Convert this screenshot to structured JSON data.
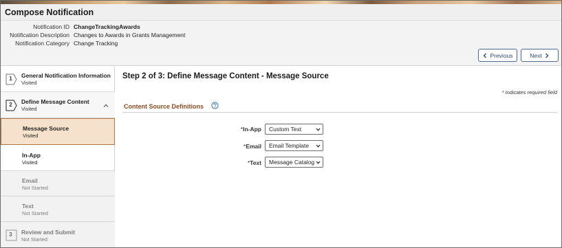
{
  "title": "Compose Notification",
  "header": {
    "fields": [
      {
        "label": "Notification ID",
        "value": "ChangeTrackingAwards"
      },
      {
        "label": "Notification Description",
        "value": "Changes to Awards in Grants Management"
      },
      {
        "label": "Notification Category",
        "value": "Change Tracking"
      }
    ],
    "previous_label": "Previous",
    "next_label": "Next"
  },
  "sidebar": {
    "steps": [
      {
        "number": "1",
        "title": "General Notification Information",
        "status": "Visited"
      },
      {
        "number": "2",
        "title": "Define Message Content",
        "status": "Visited"
      },
      {
        "number": "3",
        "title": "Review and Submit",
        "status": "Not Started"
      }
    ],
    "substeps": [
      {
        "title": "Message Source",
        "status": "Visited",
        "state": "active"
      },
      {
        "title": "In-App",
        "status": "Visited",
        "state": "normal"
      },
      {
        "title": "Email",
        "status": "Not Started",
        "state": "disabled"
      },
      {
        "title": "Text",
        "status": "Not Started",
        "state": "disabled"
      }
    ]
  },
  "main": {
    "heading": "Step 2 of 3: Define Message Content - Message Source",
    "required_note": "* Indicates required field",
    "section_title": "Content Source Definitions",
    "fields": [
      {
        "required_mark": "*",
        "label": "In-App",
        "value": "Custom Text"
      },
      {
        "required_mark": "*",
        "label": "Email",
        "value": "Email Template"
      },
      {
        "required_mark": "*",
        "label": "Text",
        "value": "Message Catalog"
      }
    ]
  },
  "colors": {
    "accent": "#8a4b22",
    "active_bg": "#f6e2cc",
    "button_border": "#4f6a8a"
  }
}
